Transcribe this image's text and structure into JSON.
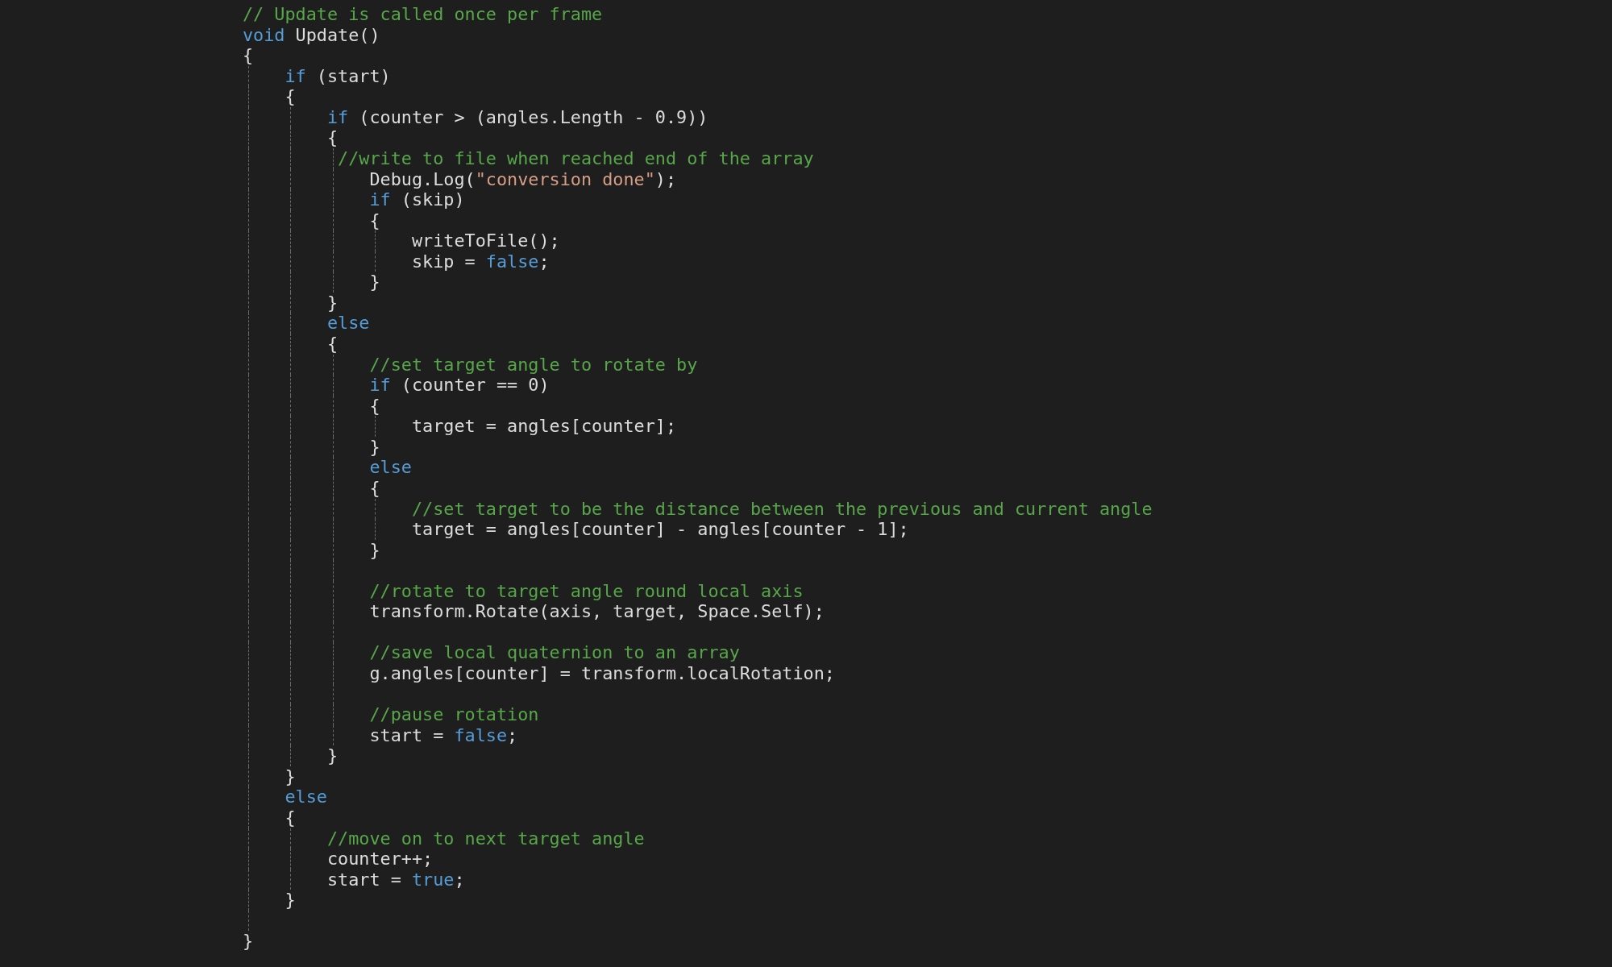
{
  "editor": {
    "lines": [
      {
        "kind": "code",
        "tokens": [
          {
            "kind": "comment",
            "text": "// Update is called once per frame"
          }
        ]
      },
      {
        "kind": "code",
        "tokens": [
          {
            "kind": "keyword",
            "text": "void"
          },
          {
            "kind": "plain",
            "text": " Update()"
          }
        ]
      },
      {
        "kind": "code",
        "tokens": [
          {
            "kind": "plain",
            "text": "{"
          }
        ]
      },
      {
        "kind": "code",
        "tokens": [
          {
            "kind": "keyword",
            "text": "    if"
          },
          {
            "kind": "plain",
            "text": " (start)"
          }
        ]
      },
      {
        "kind": "code",
        "tokens": [
          {
            "kind": "plain",
            "text": "    {"
          }
        ]
      },
      {
        "kind": "code",
        "tokens": [
          {
            "kind": "keyword",
            "text": "        if"
          },
          {
            "kind": "plain",
            "text": " (counter > (angles.Length - 0.9))"
          }
        ]
      },
      {
        "kind": "code",
        "tokens": [
          {
            "kind": "plain",
            "text": "        {"
          }
        ]
      },
      {
        "kind": "code",
        "tokens": [
          {
            "kind": "comment",
            "text": "         //write to file when reached end of the array"
          }
        ]
      },
      {
        "kind": "code",
        "tokens": [
          {
            "kind": "plain",
            "text": "            Debug.Log("
          },
          {
            "kind": "string",
            "text": "\"conversion done\""
          },
          {
            "kind": "plain",
            "text": ");"
          }
        ]
      },
      {
        "kind": "code",
        "tokens": [
          {
            "kind": "keyword",
            "text": "            if"
          },
          {
            "kind": "plain",
            "text": " (skip)"
          }
        ]
      },
      {
        "kind": "code",
        "tokens": [
          {
            "kind": "plain",
            "text": "            {"
          }
        ]
      },
      {
        "kind": "code",
        "tokens": [
          {
            "kind": "plain",
            "text": "                writeToFile();"
          }
        ]
      },
      {
        "kind": "code",
        "tokens": [
          {
            "kind": "plain",
            "text": "                skip = "
          },
          {
            "kind": "keyword",
            "text": "false"
          },
          {
            "kind": "plain",
            "text": ";"
          }
        ]
      },
      {
        "kind": "code",
        "tokens": [
          {
            "kind": "plain",
            "text": "            }"
          }
        ]
      },
      {
        "kind": "code",
        "tokens": [
          {
            "kind": "plain",
            "text": "        }"
          }
        ]
      },
      {
        "kind": "code",
        "tokens": [
          {
            "kind": "keyword",
            "text": "        else"
          }
        ]
      },
      {
        "kind": "code",
        "tokens": [
          {
            "kind": "plain",
            "text": "        {"
          }
        ]
      },
      {
        "kind": "code",
        "tokens": [
          {
            "kind": "comment",
            "text": "            //set target angle to rotate by"
          }
        ]
      },
      {
        "kind": "code",
        "tokens": [
          {
            "kind": "keyword",
            "text": "            if"
          },
          {
            "kind": "plain",
            "text": " (counter == 0)"
          }
        ]
      },
      {
        "kind": "code",
        "tokens": [
          {
            "kind": "plain",
            "text": "            {"
          }
        ]
      },
      {
        "kind": "code",
        "tokens": [
          {
            "kind": "plain",
            "text": "                target = angles[counter];"
          }
        ]
      },
      {
        "kind": "code",
        "tokens": [
          {
            "kind": "plain",
            "text": "            }"
          }
        ]
      },
      {
        "kind": "code",
        "tokens": [
          {
            "kind": "keyword",
            "text": "            else"
          }
        ]
      },
      {
        "kind": "code",
        "tokens": [
          {
            "kind": "plain",
            "text": "            {"
          }
        ]
      },
      {
        "kind": "code",
        "tokens": [
          {
            "kind": "comment",
            "text": "                //set target to be the distance between the previous and current angle"
          }
        ]
      },
      {
        "kind": "code",
        "tokens": [
          {
            "kind": "plain",
            "text": "                target = angles[counter] - angles[counter - 1];"
          }
        ]
      },
      {
        "kind": "code",
        "tokens": [
          {
            "kind": "plain",
            "text": "            }"
          }
        ]
      },
      {
        "kind": "blank"
      },
      {
        "kind": "code",
        "tokens": [
          {
            "kind": "comment",
            "text": "            //rotate to target angle round local axis"
          }
        ]
      },
      {
        "kind": "code",
        "tokens": [
          {
            "kind": "plain",
            "text": "            transform.Rotate(axis, target, Space.Self);"
          }
        ]
      },
      {
        "kind": "blank"
      },
      {
        "kind": "code",
        "tokens": [
          {
            "kind": "comment",
            "text": "            //save local quaternion to an array"
          }
        ]
      },
      {
        "kind": "code",
        "tokens": [
          {
            "kind": "plain",
            "text": "            g.angles[counter] = transform.localRotation;"
          }
        ]
      },
      {
        "kind": "blank"
      },
      {
        "kind": "code",
        "tokens": [
          {
            "kind": "comment",
            "text": "            //pause rotation"
          }
        ]
      },
      {
        "kind": "code",
        "tokens": [
          {
            "kind": "plain",
            "text": "            start = "
          },
          {
            "kind": "keyword",
            "text": "false"
          },
          {
            "kind": "plain",
            "text": ";"
          }
        ]
      },
      {
        "kind": "code",
        "tokens": [
          {
            "kind": "plain",
            "text": "        }"
          }
        ]
      },
      {
        "kind": "code",
        "tokens": [
          {
            "kind": "plain",
            "text": "    }"
          }
        ]
      },
      {
        "kind": "code",
        "tokens": [
          {
            "kind": "keyword",
            "text": "    else"
          }
        ]
      },
      {
        "kind": "code",
        "tokens": [
          {
            "kind": "plain",
            "text": "    {"
          }
        ]
      },
      {
        "kind": "code",
        "tokens": [
          {
            "kind": "comment",
            "text": "        //move on to next target angle"
          }
        ]
      },
      {
        "kind": "code",
        "tokens": [
          {
            "kind": "plain",
            "text": "        counter++;"
          }
        ]
      },
      {
        "kind": "code",
        "tokens": [
          {
            "kind": "plain",
            "text": "        start = "
          },
          {
            "kind": "keyword",
            "text": "true"
          },
          {
            "kind": "plain",
            "text": ";"
          }
        ]
      },
      {
        "kind": "code",
        "tokens": [
          {
            "kind": "plain",
            "text": "    }"
          }
        ]
      },
      {
        "kind": "blank"
      },
      {
        "kind": "code",
        "tokens": [
          {
            "kind": "plain",
            "text": "}"
          }
        ]
      }
    ]
  }
}
